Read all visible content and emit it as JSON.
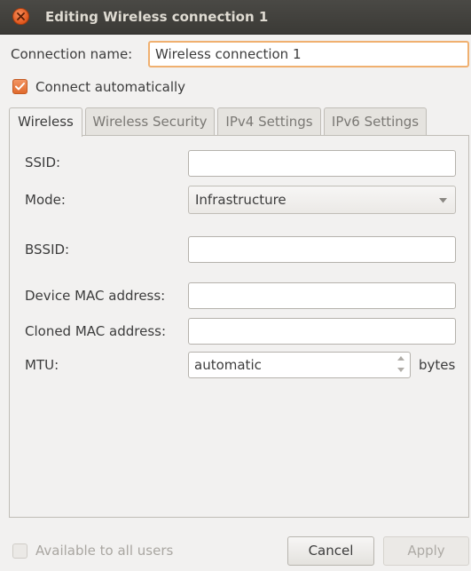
{
  "window": {
    "title": "Editing Wireless connection 1"
  },
  "connection": {
    "name_label": "Connection name:",
    "name_value": "Wireless connection 1",
    "auto_connect_label": "Connect automatically",
    "auto_connect_checked": true
  },
  "tabs": [
    {
      "label": "Wireless",
      "active": true
    },
    {
      "label": "Wireless Security",
      "active": false
    },
    {
      "label": "IPv4 Settings",
      "active": false
    },
    {
      "label": "IPv6 Settings",
      "active": false
    }
  ],
  "wireless": {
    "ssid_label": "SSID:",
    "ssid_value": "",
    "mode_label": "Mode:",
    "mode_value": "Infrastructure",
    "bssid_label": "BSSID:",
    "bssid_value": "",
    "device_mac_label": "Device MAC address:",
    "device_mac_value": "",
    "cloned_mac_label": "Cloned MAC address:",
    "cloned_mac_value": "",
    "mtu_label": "MTU:",
    "mtu_value": "automatic",
    "mtu_unit": "bytes"
  },
  "footer": {
    "all_users_label": "Available to all users",
    "all_users_checked": false,
    "cancel_label": "Cancel",
    "apply_label": "Apply"
  },
  "colors": {
    "accent": "#e06a2d",
    "focus_border": "#f0b070",
    "titlebar": "#3b3a36"
  }
}
